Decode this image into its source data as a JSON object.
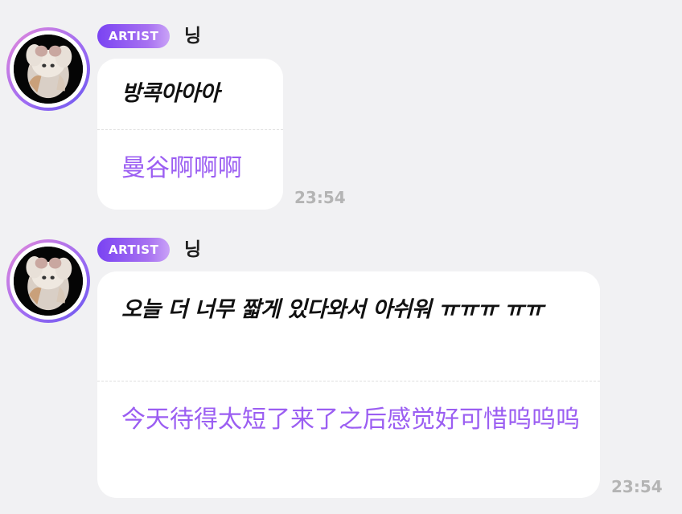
{
  "messages": [
    {
      "badge": "ARTIST",
      "name": "닝",
      "text_ko": "방콕아아아",
      "text_zh": "曼谷啊啊啊",
      "time": "23:54"
    },
    {
      "badge": "ARTIST",
      "name": "닝",
      "text_ko": "오늘 더 너무 짧게 있다와서 아쉬워 ㅠㅠㅠ ㅠㅠ",
      "text_zh": "今天待得太短了来了之后感觉好可惜呜呜呜",
      "time": "23:54"
    }
  ],
  "colors": {
    "background": "#f1f1f3",
    "bubble": "#ffffff",
    "translation_text": "#9b5ef2",
    "badge_gradient_start": "#7a43f2",
    "badge_gradient_end": "#c9a2f7",
    "timestamp": "#b4b4b4"
  },
  "icons": {
    "avatar": "profile-photo-white-cat"
  }
}
